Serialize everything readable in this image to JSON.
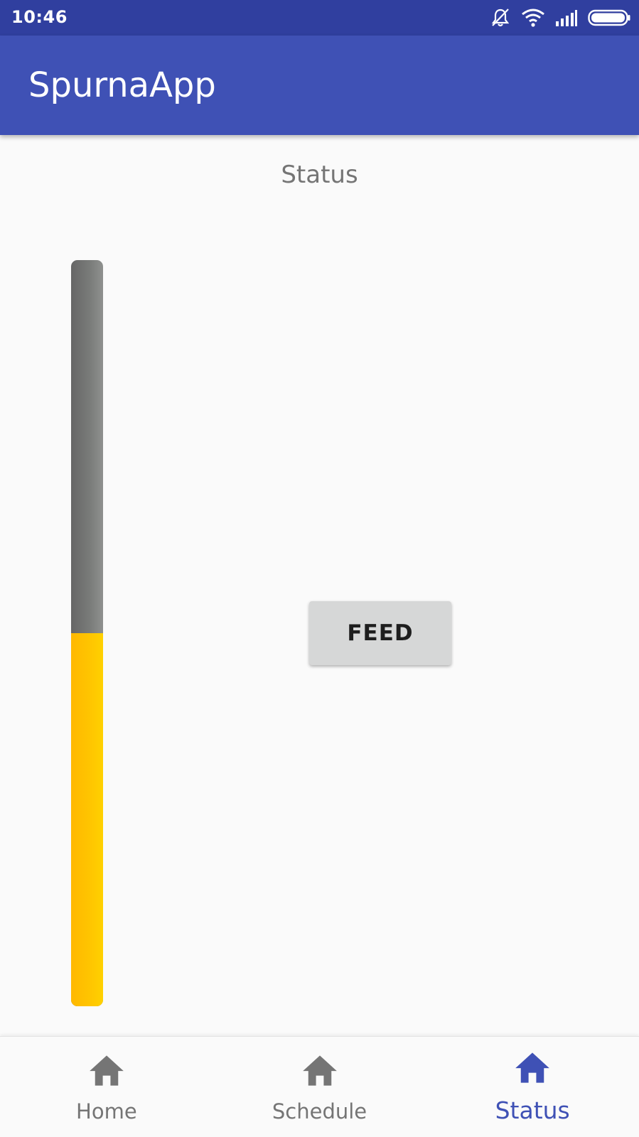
{
  "status_bar": {
    "time": "10:46",
    "icons": [
      "notifications-off-icon",
      "wifi-icon",
      "signal-icon",
      "battery-icon"
    ],
    "background": "#303f9f"
  },
  "app_bar": {
    "title": "SpurnaApp",
    "background": "#3f51b5"
  },
  "main": {
    "title": "Status",
    "level_indicator": {
      "fill_fraction": 0.5,
      "fill_color": "#ffc107",
      "track_color": "#757575"
    },
    "feed_button": {
      "label": "FEED"
    }
  },
  "bottom_nav": {
    "items": [
      {
        "label": "Home",
        "icon": "home-icon",
        "active": false
      },
      {
        "label": "Schedule",
        "icon": "home-icon",
        "active": false
      },
      {
        "label": "Status",
        "icon": "home-icon",
        "active": true
      }
    ],
    "active_color": "#3f51b5",
    "inactive_color": "#757575"
  }
}
